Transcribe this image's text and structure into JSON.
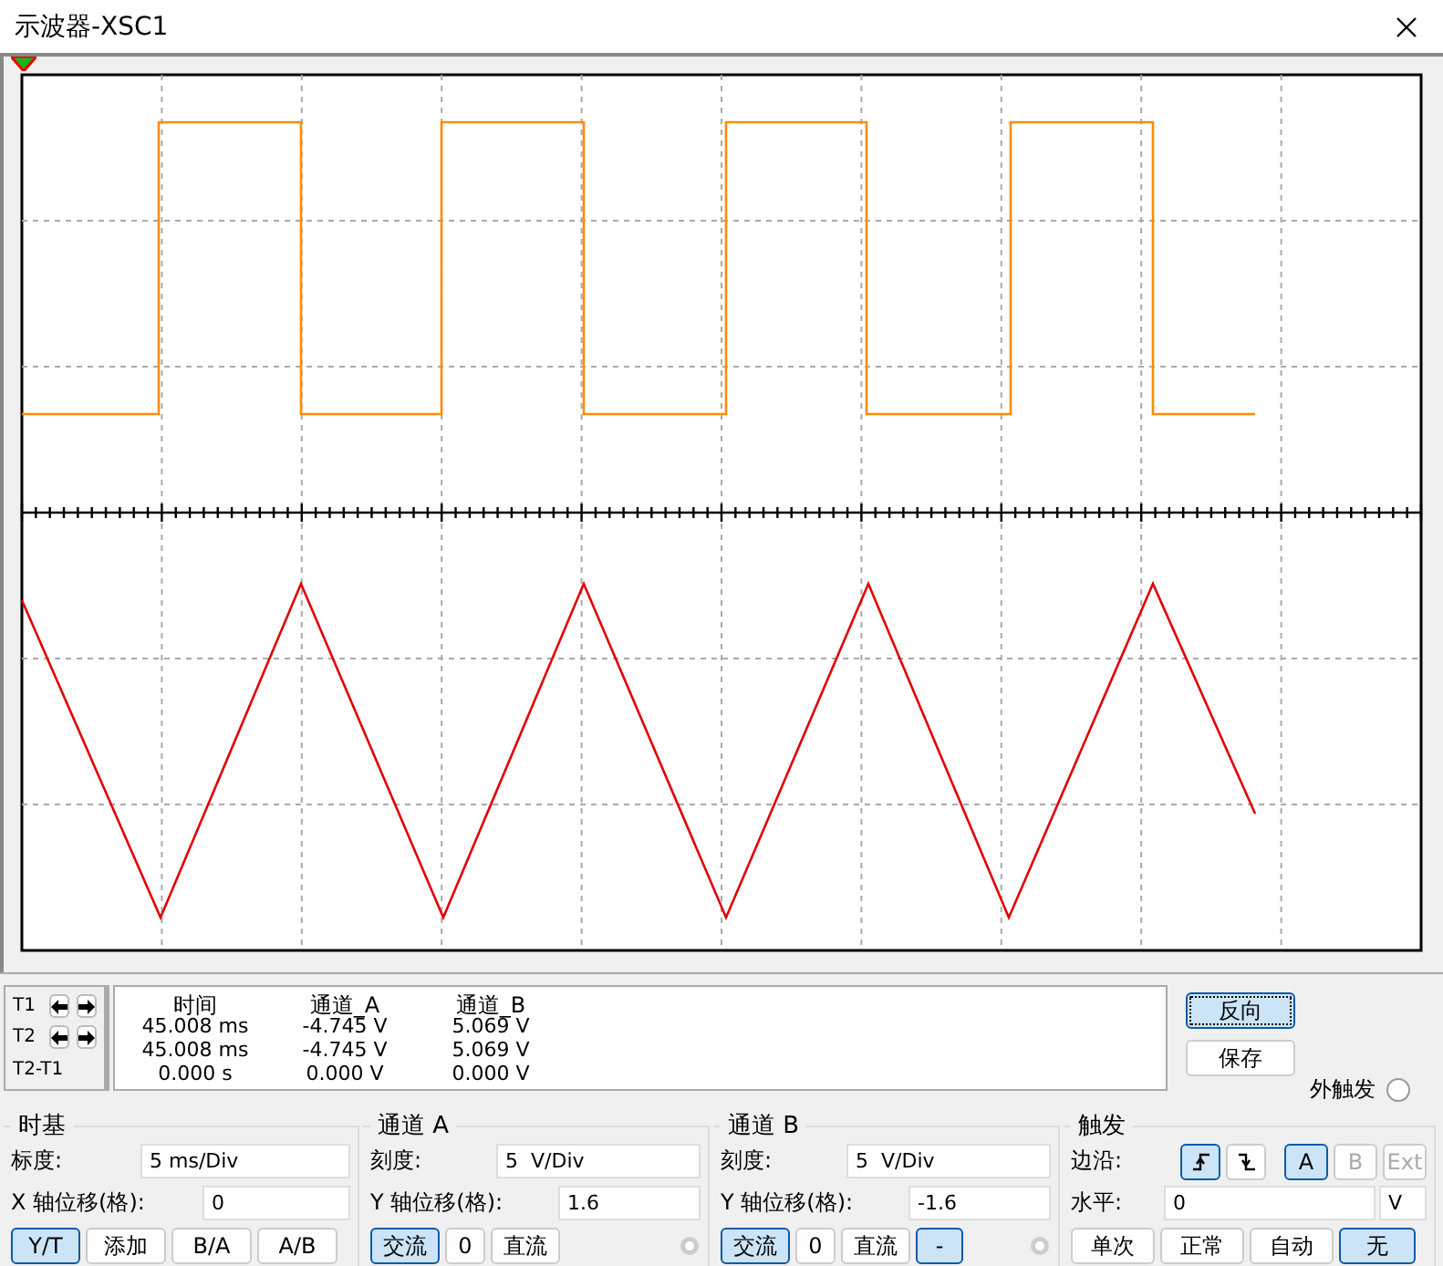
{
  "window": {
    "title": "示波器-XSC1"
  },
  "cursors": [
    {
      "label": "T1",
      "arrows": true
    },
    {
      "label": "T2",
      "arrows": true
    },
    {
      "label": "T2-T1",
      "arrows": false
    }
  ],
  "readout": {
    "columns": [
      "时间",
      "通道_A",
      "通道_B"
    ],
    "rows": [
      [
        "45.008 ms",
        "-4.745 V",
        "5.069 V"
      ],
      [
        "45.008 ms",
        "-4.745 V",
        "5.069 V"
      ],
      [
        "0.000 s",
        "0.000 V",
        "0.000 V"
      ]
    ]
  },
  "actions": [
    {
      "label": "反向",
      "focused": true
    },
    {
      "label": "保存",
      "focused": false
    }
  ],
  "ext_trigger": {
    "label": "外触发",
    "selected": false
  },
  "timebase": {
    "title": "时基",
    "scale": {
      "label": "标度:",
      "value": "5 ms/Div"
    },
    "offset": {
      "label": "X 轴位移(格):",
      "value": "0"
    },
    "modes": [
      {
        "label": "Y/T",
        "selected": true
      },
      {
        "label": "添加",
        "selected": false
      },
      {
        "label": "B/A",
        "selected": false
      },
      {
        "label": "A/B",
        "selected": false
      }
    ]
  },
  "channels": [
    {
      "title": "通道 A",
      "scale": {
        "label": "刻度:",
        "value": "5  V/Div"
      },
      "offset": {
        "label": "Y 轴位移(格):",
        "value": "1.6"
      },
      "coupling": [
        {
          "label": "交流",
          "selected": true
        },
        {
          "label": "0",
          "selected": false
        },
        {
          "label": "直流",
          "selected": false
        }
      ]
    },
    {
      "title": "通道 B",
      "scale": {
        "label": "刻度:",
        "value": "5  V/Div"
      },
      "offset": {
        "label": "Y 轴位移(格):",
        "value": "-1.6"
      },
      "coupling": [
        {
          "label": "交流",
          "selected": true
        },
        {
          "label": "0",
          "selected": false
        },
        {
          "label": "直流",
          "selected": false
        },
        {
          "label": "-",
          "selected": true
        }
      ]
    }
  ],
  "trigger": {
    "title": "触发",
    "edge_label": "边沿:",
    "edges": [
      {
        "kind": "rising",
        "selected": true
      },
      {
        "kind": "falling",
        "selected": false
      }
    ],
    "sources": [
      {
        "label": "A",
        "selected": true,
        "disabled": false
      },
      {
        "label": "B",
        "selected": false,
        "disabled": true
      },
      {
        "label": "Ext",
        "selected": false,
        "disabled": true
      }
    ],
    "level": {
      "label": "水平:",
      "value": "0",
      "unit": "V"
    },
    "modes": [
      {
        "label": "单次",
        "selected": false
      },
      {
        "label": "正常",
        "selected": false
      },
      {
        "label": "自动",
        "selected": false
      },
      {
        "label": "无",
        "selected": true
      }
    ]
  }
}
